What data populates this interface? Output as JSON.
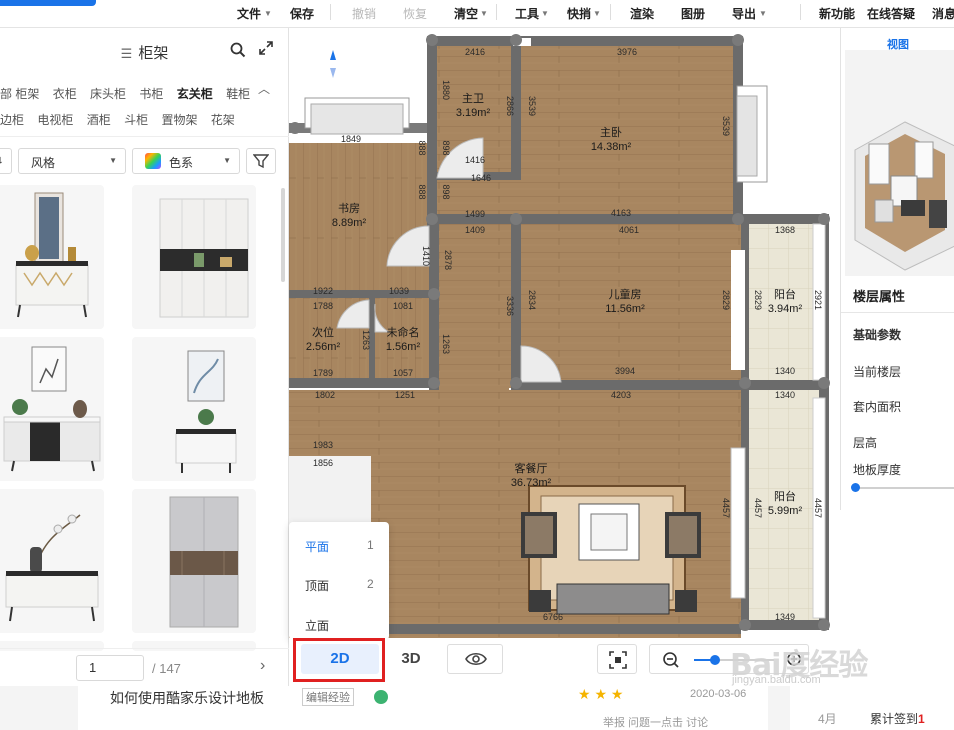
{
  "toolbar": {
    "items": [
      {
        "label": "文件",
        "disabled": false
      },
      {
        "label": "保存",
        "disabled": false
      },
      {
        "label": "撤销",
        "disabled": true
      },
      {
        "label": "恢复",
        "disabled": true
      },
      {
        "label": "清空",
        "disabled": false
      },
      {
        "label": "工具",
        "disabled": false
      },
      {
        "label": "快捎",
        "disabled": false
      },
      {
        "label": "渲染",
        "disabled": false
      },
      {
        "label": "图册",
        "disabled": false
      },
      {
        "label": "导出",
        "disabled": false
      },
      {
        "label": "新功能",
        "disabled": false
      },
      {
        "label": "在线答疑",
        "disabled": false
      },
      {
        "label": "消息",
        "disabled": false
      }
    ]
  },
  "catalog": {
    "title": "柜架",
    "categories_row1": [
      "部 柜架",
      "衣柜",
      "床头柜",
      "书柜",
      "玄关柜",
      "鞋柜"
    ],
    "categories_row2": [
      "边柜",
      "电视柜",
      "酒柜",
      "斗柜",
      "置物架",
      "花架"
    ],
    "active_category": "玄关柜",
    "filters": {
      "style": "风格",
      "color": "色系"
    },
    "pager": {
      "current": "1",
      "total": "/ 147"
    }
  },
  "plan": {
    "rooms": [
      {
        "name": "主卫",
        "area": "3.19m²"
      },
      {
        "name": "主卧",
        "area": "14.38m²"
      },
      {
        "name": "书房",
        "area": "8.89m²"
      },
      {
        "name": "儿童房",
        "area": "11.56m²"
      },
      {
        "name": "阳台",
        "area": "3.94m²"
      },
      {
        "name": "次位",
        "area": "2.56m²"
      },
      {
        "name": "未命名",
        "area": "1.56m²"
      },
      {
        "name": "客餐厅",
        "area": "36.73m²"
      },
      {
        "name": "阳台",
        "area": "5.99m²"
      }
    ],
    "dims": {
      "d1": "2416",
      "d2": "3976",
      "d3": "1849",
      "d4": "1416",
      "d5": "1646",
      "d6": "1499",
      "d7": "4163",
      "d8": "1409",
      "d9": "4061",
      "d10": "1368",
      "d11": "1922",
      "d12": "1039",
      "d13": "1788",
      "d14": "1081",
      "d15": "1789",
      "d16": "1057",
      "d17": "3994",
      "d18": "1340",
      "d19": "1802",
      "d20": "1251",
      "d21": "4203",
      "d22": "1340",
      "d23": "1983",
      "d24": "1856",
      "d25": "6766",
      "d26": "1349",
      "v1": "1880",
      "v2": "2866",
      "v3": "3539",
      "v4": "888",
      "v5": "898",
      "v6": "1410",
      "v7": "2878",
      "v8": "2834",
      "v9": "3336",
      "v10": "2921",
      "v11": "2829",
      "v12": "1263",
      "v13": "1263",
      "v14": "4457",
      "v15": "4457"
    }
  },
  "view_popup": {
    "items": [
      {
        "label": "平面",
        "num": "1"
      },
      {
        "label": "顶面",
        "num": "2"
      },
      {
        "label": "立面",
        "num": ""
      }
    ]
  },
  "bottom_bar": {
    "btn_2d": "2D",
    "btn_3d": "3D"
  },
  "right_panel": {
    "view_label": "视图",
    "floor_title": "楼层属性",
    "basic_params": "基础参数",
    "current_floor": "当前楼层",
    "inner_area": "套内面积",
    "floor_height": "层高",
    "floor_thickness": "地板厚度"
  },
  "article": {
    "title": "如何使用酷家乐设计地板",
    "tag": "编辑经验",
    "meta": "举报 问题一点击 讨论",
    "date": "2020-03-06"
  },
  "side": {
    "month": "4月",
    "sign_prefix": "累计签到",
    "sign_count": "1"
  },
  "watermark": {
    "logo": "Bai度经验",
    "url": "jingyan.baidu.com"
  },
  "colors": {
    "accent": "#1a73e8",
    "highlight_frame": "#e02020",
    "wall": "#6b6b6b",
    "floor": "#a88660"
  }
}
